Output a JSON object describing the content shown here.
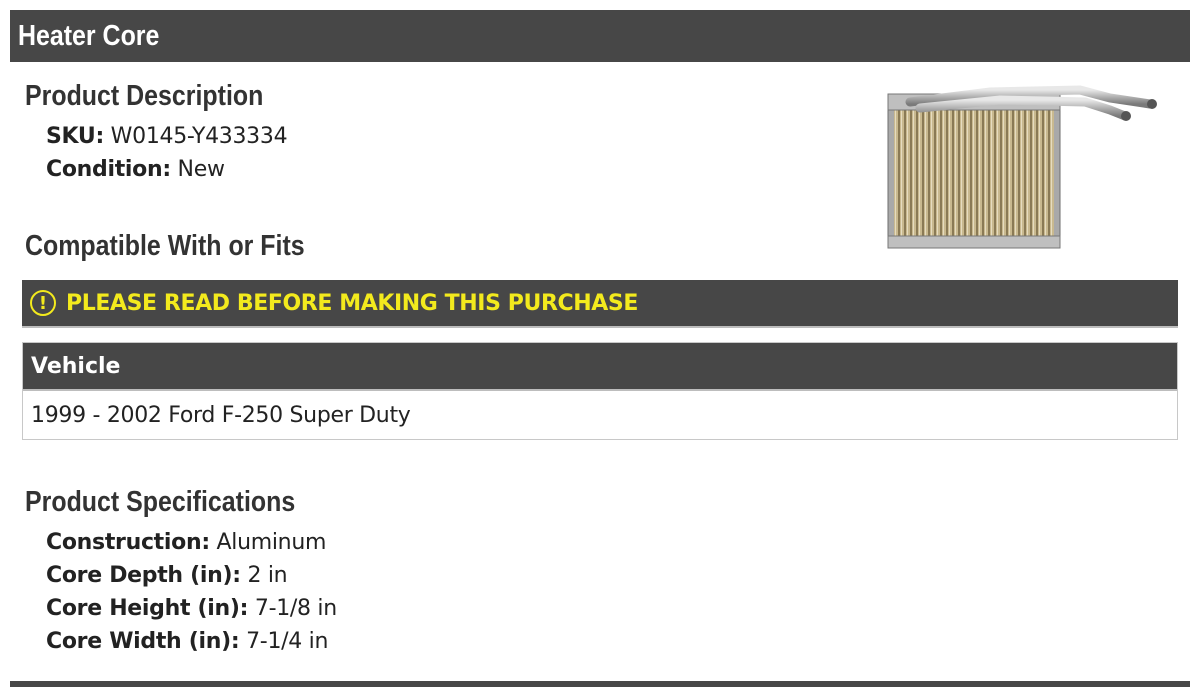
{
  "title": "Heater Core",
  "product_description": {
    "heading": "Product Description",
    "sku_label": "SKU:",
    "sku_value": "W0145-Y433334",
    "condition_label": "Condition:",
    "condition_value": "New"
  },
  "compatibility": {
    "heading": "Compatible With or Fits",
    "warning_icon": "!",
    "warning_text": "PLEASE READ BEFORE MAKING THIS PURCHASE",
    "table_header": "Vehicle",
    "rows": [
      "1999 - 2002 Ford F-250 Super Duty"
    ]
  },
  "specifications": {
    "heading": "Product Specifications",
    "items": [
      {
        "label": "Construction:",
        "value": "Aluminum"
      },
      {
        "label": "Core Depth (in):",
        "value": "2 in"
      },
      {
        "label": "Core Height (in):",
        "value": "7-1/8 in"
      },
      {
        "label": "Core Width (in):",
        "value": "7-1/4 in"
      }
    ]
  },
  "image": {
    "icon": "heater-core-product-photo"
  },
  "colors": {
    "bar": "#474747",
    "warning": "#f3ea1d"
  }
}
